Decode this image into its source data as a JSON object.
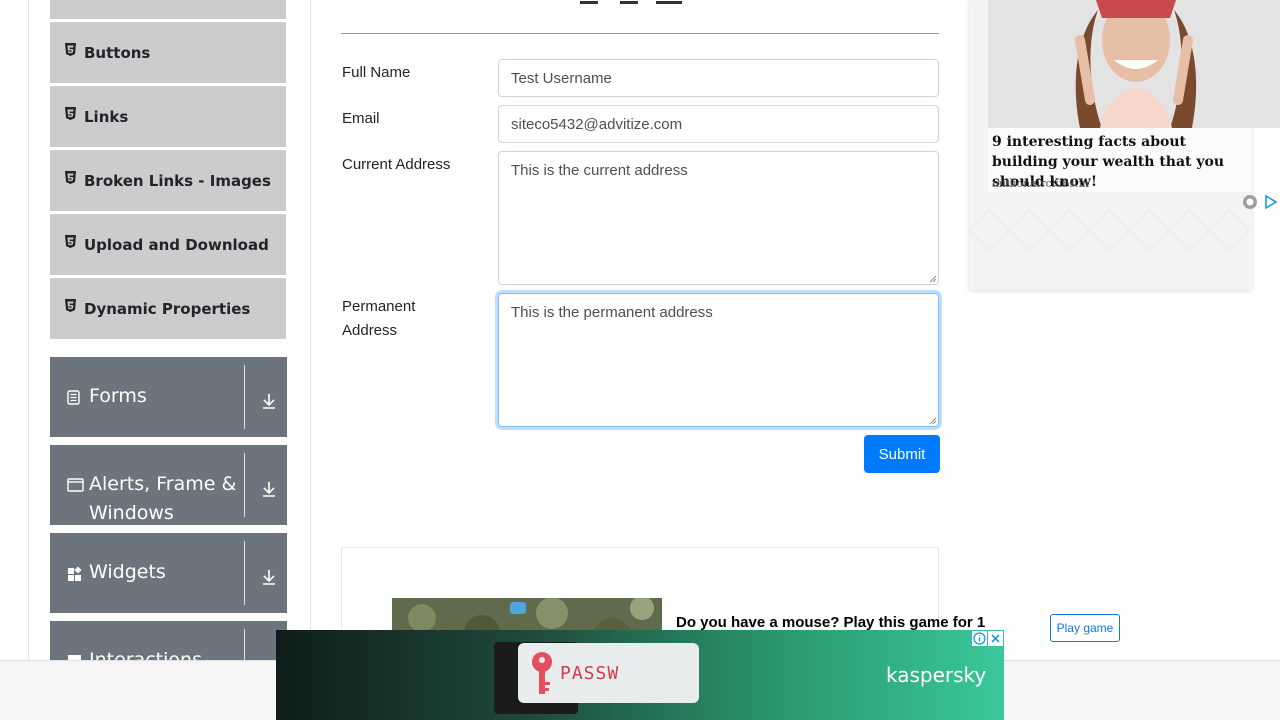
{
  "sidebar": {
    "elements_items": [
      {
        "label": "Buttons"
      },
      {
        "label": "Links"
      },
      {
        "label": "Broken Links - Images"
      },
      {
        "label": "Upload and Download"
      },
      {
        "label": "Dynamic Properties"
      }
    ],
    "groups": [
      {
        "label": "Forms"
      },
      {
        "label": "Alerts, Frame &",
        "label2": "Windows"
      },
      {
        "label": "Widgets"
      },
      {
        "label": "Interactions"
      }
    ]
  },
  "form": {
    "full_name_label": "Full Name",
    "full_name_value": "Test Username",
    "email_label": "Email",
    "email_value": "siteco5432@advitize.com",
    "current_address_label": "Current Address",
    "current_address_value": "This is the current address",
    "permanent_address_label_1": "Permanent",
    "permanent_address_label_2": "Address",
    "permanent_address_value": "This is the permanent address",
    "submit_label": "Submit"
  },
  "right_ad": {
    "headline": "9 interesting facts about building your wealth that you should know!",
    "source": "millionairclubs.in"
  },
  "bottom_ad": {
    "game_text": "Do you have a mouse? Play this game for 1",
    "play_label": "Play game"
  },
  "banner": {
    "password_text": "PASSW",
    "brand": "kaspersky"
  },
  "colors": {
    "primary": "#007bff",
    "sidebar_group": "#6c757d",
    "sidebar_item": "#cccccc"
  }
}
